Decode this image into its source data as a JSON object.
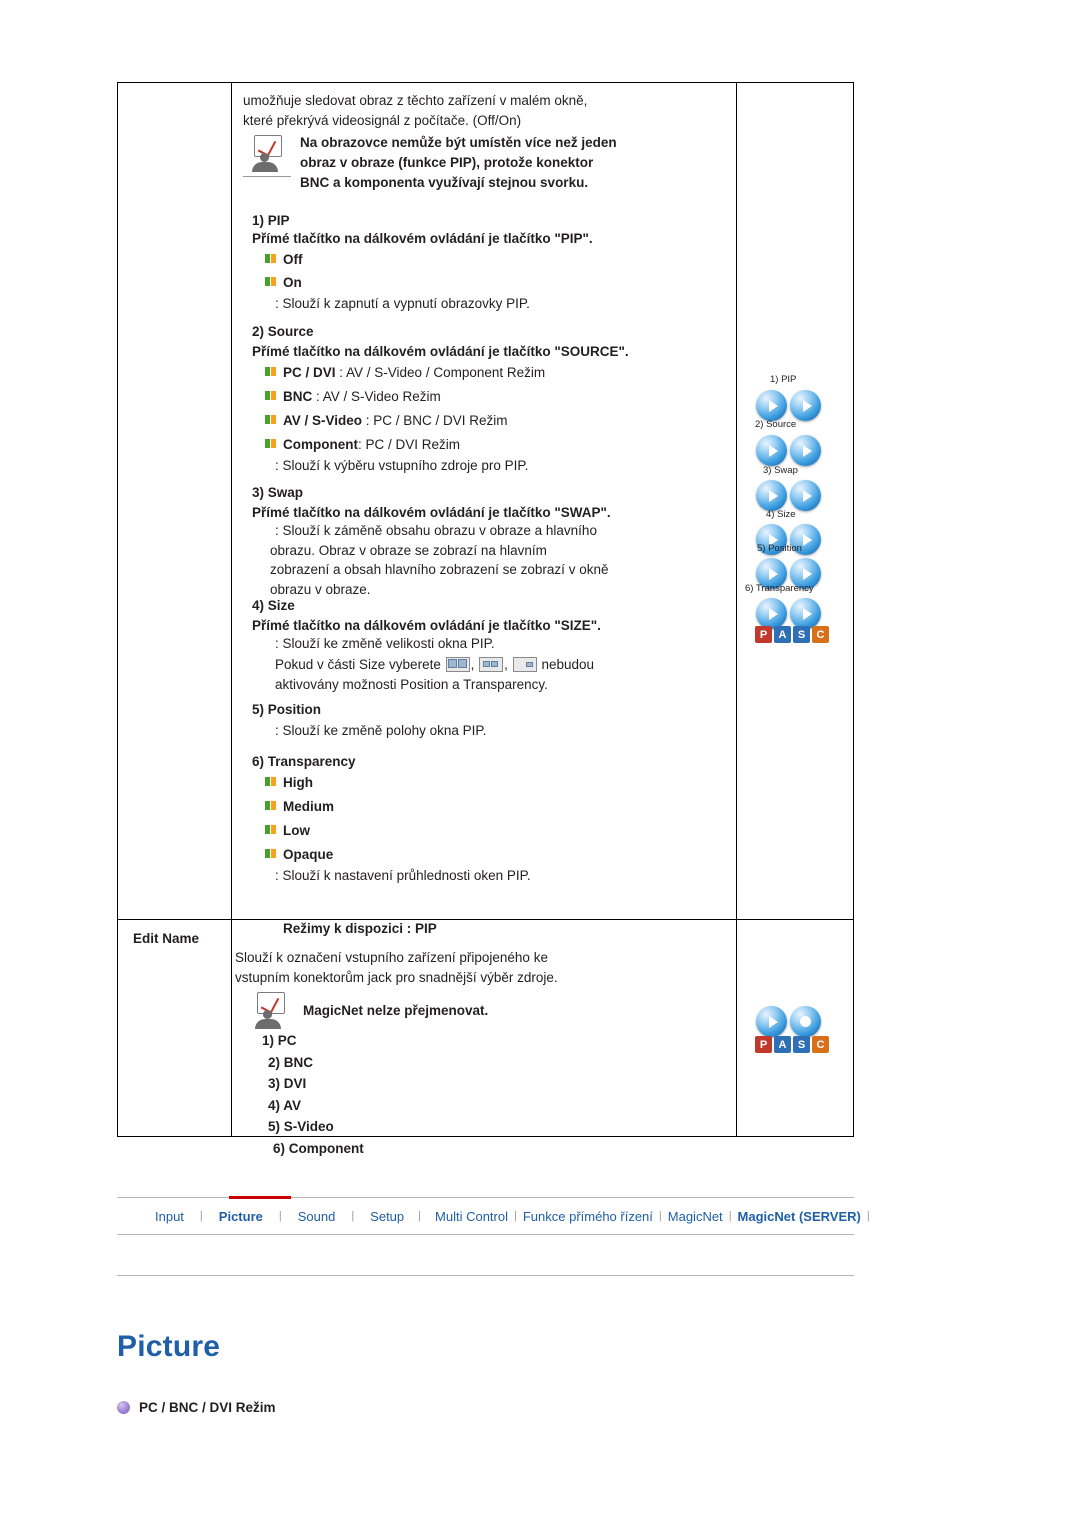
{
  "table": {
    "intro": {
      "line1": "umožňuje sledovat obraz z těchto zařízení v malém okně,",
      "line2": "které překrývá videosignál z počítače. (Off/On)"
    },
    "note1": {
      "line1": "Na obrazovce nemůže být umístěn více než jeden",
      "line2": "obraz v obraze (funkce PIP), protože konektor",
      "line3": "BNC a komponenta využívají stejnou svorku."
    },
    "sections": [
      {
        "heading": "1) PIP",
        "remote": "Přímé tlačítko na dálkovém ovládání je tlačítko \"PIP\".",
        "options": [
          "Off",
          "On"
        ],
        "desc": ": Slouží k zapnutí a vypnutí obrazovky PIP."
      },
      {
        "heading": "2) Source",
        "remote": "Přímé tlačítko na dálkovém ovládání je tlačítko \"SOURCE\".",
        "option_rows": [
          {
            "bold": "PC / DVI",
            "rest": " : AV / S-Video / Component Režim"
          },
          {
            "bold": "BNC",
            "rest": " : AV / S-Video Režim"
          },
          {
            "bold": "AV / S-Video",
            "rest": " : PC / BNC / DVI Režim"
          },
          {
            "bold": "Component",
            "rest": ": PC / DVI Režim"
          }
        ],
        "desc": ": Slouží k výběru vstupního zdroje pro PIP."
      },
      {
        "heading": "3) Swap",
        "remote": "Přímé tlačítko na dálkovém ovládání je tlačítko \"SWAP\".",
        "desc_lines": [
          ": Slouží k záměně obsahu obrazu v obraze a hlavního",
          "obrazu. Obraz v obraze se zobrazí na hlavním",
          "zobrazení a obsah hlavního zobrazení se zobrazí v okně",
          "obrazu v obraze."
        ]
      },
      {
        "heading": "4) Size",
        "remote": "Přímé tlačítko na dálkovém ovládání je tlačítko \"SIZE\".",
        "desc": ": Slouží ke změně velikosti okna PIP.",
        "size_line_pre": "Pokud v části Size vyberete",
        "size_line_post": "nebudou",
        "size_line_next": "aktivovány možnosti Position a Transparency."
      },
      {
        "heading": "5) Position",
        "desc": ": Slouží ke změně polohy okna PIP."
      },
      {
        "heading": "6) Transparency",
        "options": [
          "High",
          "Medium",
          "Low",
          "Opaque"
        ],
        "desc": ": Slouží k nastavení průhlednosti oken PIP."
      }
    ],
    "modes_note": "Režimy k dispozici : PIP",
    "edit_name": {
      "label": "Edit Name",
      "line1": "Slouží k označení vstupního zařízení připojeného ke",
      "line2": "vstupním konektorům jack pro snadnější výběr zdroje.",
      "note": "MagicNet nelze přejmenovat.",
      "items": [
        "1) PC",
        "2) BNC",
        "3) DVI",
        "4) AV",
        "5) S-Video",
        "6) Component"
      ]
    },
    "right_panel": {
      "captions": [
        "1) PIP",
        "2) Source",
        "3) Swap",
        "4) Size",
        "5) Position",
        "6) Transparency"
      ],
      "pasc": [
        "P",
        "A",
        "S",
        "C"
      ]
    }
  },
  "nav": {
    "items": [
      {
        "label": "Input",
        "active": false
      },
      {
        "label": "Picture",
        "active": true
      },
      {
        "label": "Sound",
        "active": false
      },
      {
        "label": "Setup",
        "active": false
      },
      {
        "label": "Multi Control",
        "active": false
      },
      {
        "label": "Funkce přímého řízení",
        "active": false
      },
      {
        "label": "MagicNet",
        "active": false
      },
      {
        "label": "MagicNet (SERVER)",
        "active": true
      }
    ],
    "separator": "|"
  },
  "page": {
    "title": "Picture",
    "subhead": "PC / BNC / DVI Režim"
  },
  "colors": {
    "link_blue": "#1f5fa8",
    "accent_red": "#cc0000",
    "bullet_green": "#4aa02c",
    "bullet_orange": "#f5a21d"
  }
}
